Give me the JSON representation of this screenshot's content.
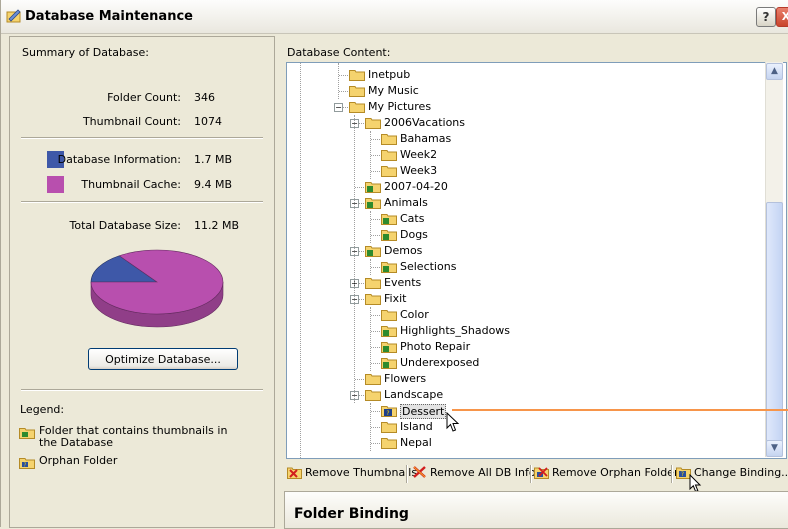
{
  "window": {
    "title": "Database Maintenance",
    "help_label": "?",
    "close_label": "X"
  },
  "summary": {
    "label": "Summary of Database:",
    "folder_count_label": "Folder Count:",
    "folder_count": "346",
    "thumbnail_count_label": "Thumbnail Count:",
    "thumbnail_count": "1074",
    "db_info_label": "Database Information:",
    "db_info_size": "1.7 MB",
    "db_info_color": "#3e58a8",
    "thumb_cache_label": "Thumbnail Cache:",
    "thumb_cache_size": "9.4 MB",
    "thumb_cache_color": "#b84fae",
    "total_label": "Total Database Size:",
    "total_size": "11.2 MB",
    "optimize_button": "Optimize Database...",
    "legend_label": "Legend:",
    "legend_items": [
      {
        "icon": "folder-thumbnails-icon",
        "text": "Folder that contains thumbnails in the Database"
      },
      {
        "icon": "orphan-folder-icon",
        "text": "Orphan Folder"
      }
    ]
  },
  "chart_data": {
    "type": "pie",
    "slices": [
      {
        "name": "Database Information",
        "value": 1.7,
        "color": "#3e58a8"
      },
      {
        "name": "Thumbnail Cache",
        "value": 9.4,
        "color": "#b84fae"
      }
    ]
  },
  "content": {
    "label": "Database Content:",
    "tree": [
      {
        "name": "Inetpub",
        "level": 2,
        "type": "plain"
      },
      {
        "name": "My Music",
        "level": 2,
        "type": "plain"
      },
      {
        "name": "My Pictures",
        "level": 2,
        "type": "plain",
        "expander": "-"
      },
      {
        "name": "2006Vacations",
        "level": 3,
        "type": "plain",
        "expander": "-"
      },
      {
        "name": "Bahamas",
        "level": 4,
        "type": "plain"
      },
      {
        "name": "Week2",
        "level": 4,
        "type": "plain"
      },
      {
        "name": "Week3",
        "level": 4,
        "type": "plain"
      },
      {
        "name": "2007-04-20",
        "level": 3,
        "type": "thumb"
      },
      {
        "name": "Animals",
        "level": 3,
        "type": "thumb",
        "expander": "-"
      },
      {
        "name": "Cats",
        "level": 4,
        "type": "thumb"
      },
      {
        "name": "Dogs",
        "level": 4,
        "type": "thumb"
      },
      {
        "name": "Demos",
        "level": 3,
        "type": "thumb",
        "expander": "-"
      },
      {
        "name": "Selections",
        "level": 4,
        "type": "thumb"
      },
      {
        "name": "Events",
        "level": 3,
        "type": "plain",
        "expander": "+"
      },
      {
        "name": "Fixit",
        "level": 3,
        "type": "plain",
        "expander": "-"
      },
      {
        "name": "Color",
        "level": 4,
        "type": "plain"
      },
      {
        "name": "Highlights_Shadows",
        "level": 4,
        "type": "thumb"
      },
      {
        "name": "Photo Repair",
        "level": 4,
        "type": "thumb"
      },
      {
        "name": "Underexposed",
        "level": 4,
        "type": "thumb"
      },
      {
        "name": "Flowers",
        "level": 3,
        "type": "plain"
      },
      {
        "name": "Landscape",
        "level": 3,
        "type": "plain",
        "expander": "-"
      },
      {
        "name": "Dessert",
        "level": 4,
        "type": "orphan",
        "selected": true
      },
      {
        "name": "Island",
        "level": 4,
        "type": "plain"
      },
      {
        "name": "Nepal",
        "level": 4,
        "type": "plain"
      }
    ]
  },
  "toolbar": {
    "remove_thumbnails": "Remove Thumbnails",
    "remove_all_db_info": "Remove All DB Info",
    "remove_orphan_folders": "Remove Orphan Folders",
    "change_binding": "Change Binding..."
  },
  "binding_panel": {
    "title": "Folder Binding"
  },
  "colors": {
    "annotation_line": "#f7954a",
    "folder": "#f5d36e",
    "thumb_folder_badge": "#2e8b2e"
  }
}
